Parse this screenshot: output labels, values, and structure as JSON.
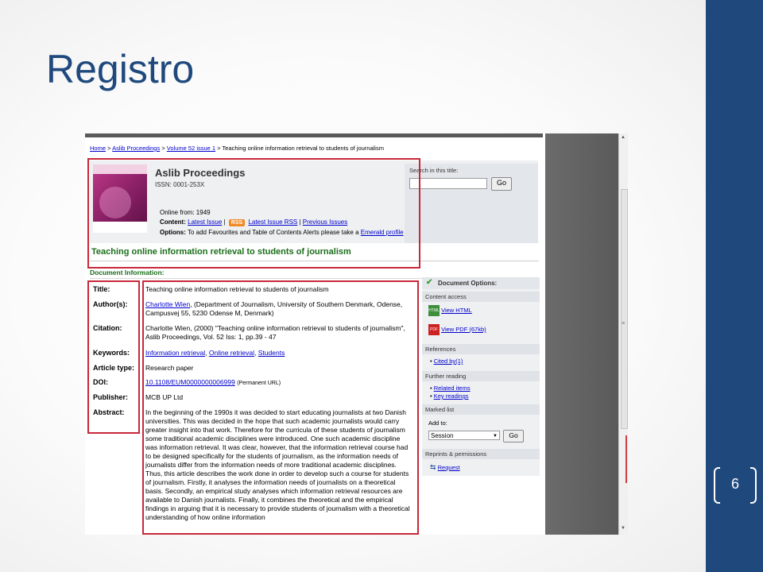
{
  "slide": {
    "title": "Registro",
    "page_number": "6"
  },
  "colors": {
    "title": "#1f497d",
    "sidebar": "#1f497d",
    "highlight_box": "#c8283a",
    "article_title": "#1a6e1a",
    "link": "#0000cc"
  },
  "breadcrumb": {
    "home": "Home",
    "sep": ">",
    "journal": "Aslib Proceedings",
    "issue": "Volume 52 issue 1",
    "current": "Teaching online information retrieval to students of journalism"
  },
  "journal": {
    "name": "Aslib Proceedings",
    "issn": "ISSN: 0001-253X",
    "online_from": "Online from: 1949",
    "content_label": "Content:",
    "latest_issue": "Latest Issue",
    "rss_badge": "RSS",
    "latest_issue_rss": "Latest Issue RSS",
    "previous_issues": "Previous Issues",
    "options_label": "Options:",
    "options_text": "To add Favourites and Table of Contents Alerts please take a",
    "emerald_profile": "Emerald profile"
  },
  "search": {
    "label": "Search in this title:",
    "value": "",
    "go": "Go"
  },
  "article_title": "Teaching online information retrieval to students of journalism",
  "document_information": {
    "heading": "Document Information:",
    "fields": {
      "title_label": "Title:",
      "title_value": "Teaching online information retrieval to students of journalism",
      "authors_label": "Author(s):",
      "author_link": "Charlotte Wien",
      "author_affil": ", (Department of Journalism, University of Southern Denmark, Odense, Campusvej 55, 5230 Odense M, Denmark)",
      "citation_label": "Citation:",
      "citation_value": "Charlotte Wien, (2000) \"Teaching online information retrieval to students of journalism\", Aslib Proceedings, Vol. 52 Iss: 1, pp.39 - 47",
      "keywords_label": "Keywords:",
      "keyword_1": "Information retrieval",
      "keyword_2": "Online retrieval",
      "keyword_3": "Students",
      "article_type_label": "Article type:",
      "article_type_value": "Research paper",
      "doi_label": "DOI:",
      "doi_link": "10.1108/EUM0000000006999",
      "doi_note": "(Permanent URL)",
      "publisher_label": "Publisher:",
      "publisher_value": "MCB UP Ltd",
      "abstract_label": "Abstract:",
      "abstract_value": "In the beginning of the 1990s it was decided to start educating journalists at two Danish universities. This was decided in the hope that such academic journalists would carry greater insight into that work. Therefore for the curricula of these students of journalism some traditional academic disciplines were introduced. One such academic discipline was information retrieval. It was clear, however, that the information retrieval course had to be designed specifically for the students of journalism, as the information needs of journalists differ from the information needs of more traditional academic disciplines. Thus, this article describes the work done in order to develop such a course for students of journalism. Firstly, it analyses the information needs of journalists on a theoretical basis. Secondly, an empirical study analyses which information retrieval resources are available to Danish journalists. Finally, it combines the theoretical and the empirical findings in arguing that it is necessary to provide students of journalism with a theoretical understanding of how online information"
    }
  },
  "document_options": {
    "heading": "Document Options:",
    "content_access": "Content access",
    "view_html": "View HTML",
    "view_pdf": "View PDF (67kb)",
    "html_icon_text": "HTML",
    "pdf_icon_text": "PDF",
    "references": "References",
    "cited_by": "Cited by(1)",
    "further_reading": "Further reading",
    "related_items": "Related items",
    "key_readings": "Key readings",
    "marked_list": "Marked list",
    "add_to": "Add to:",
    "session_option": "Session",
    "go": "Go",
    "reprints": "Reprints & permissions",
    "request": "Request"
  }
}
